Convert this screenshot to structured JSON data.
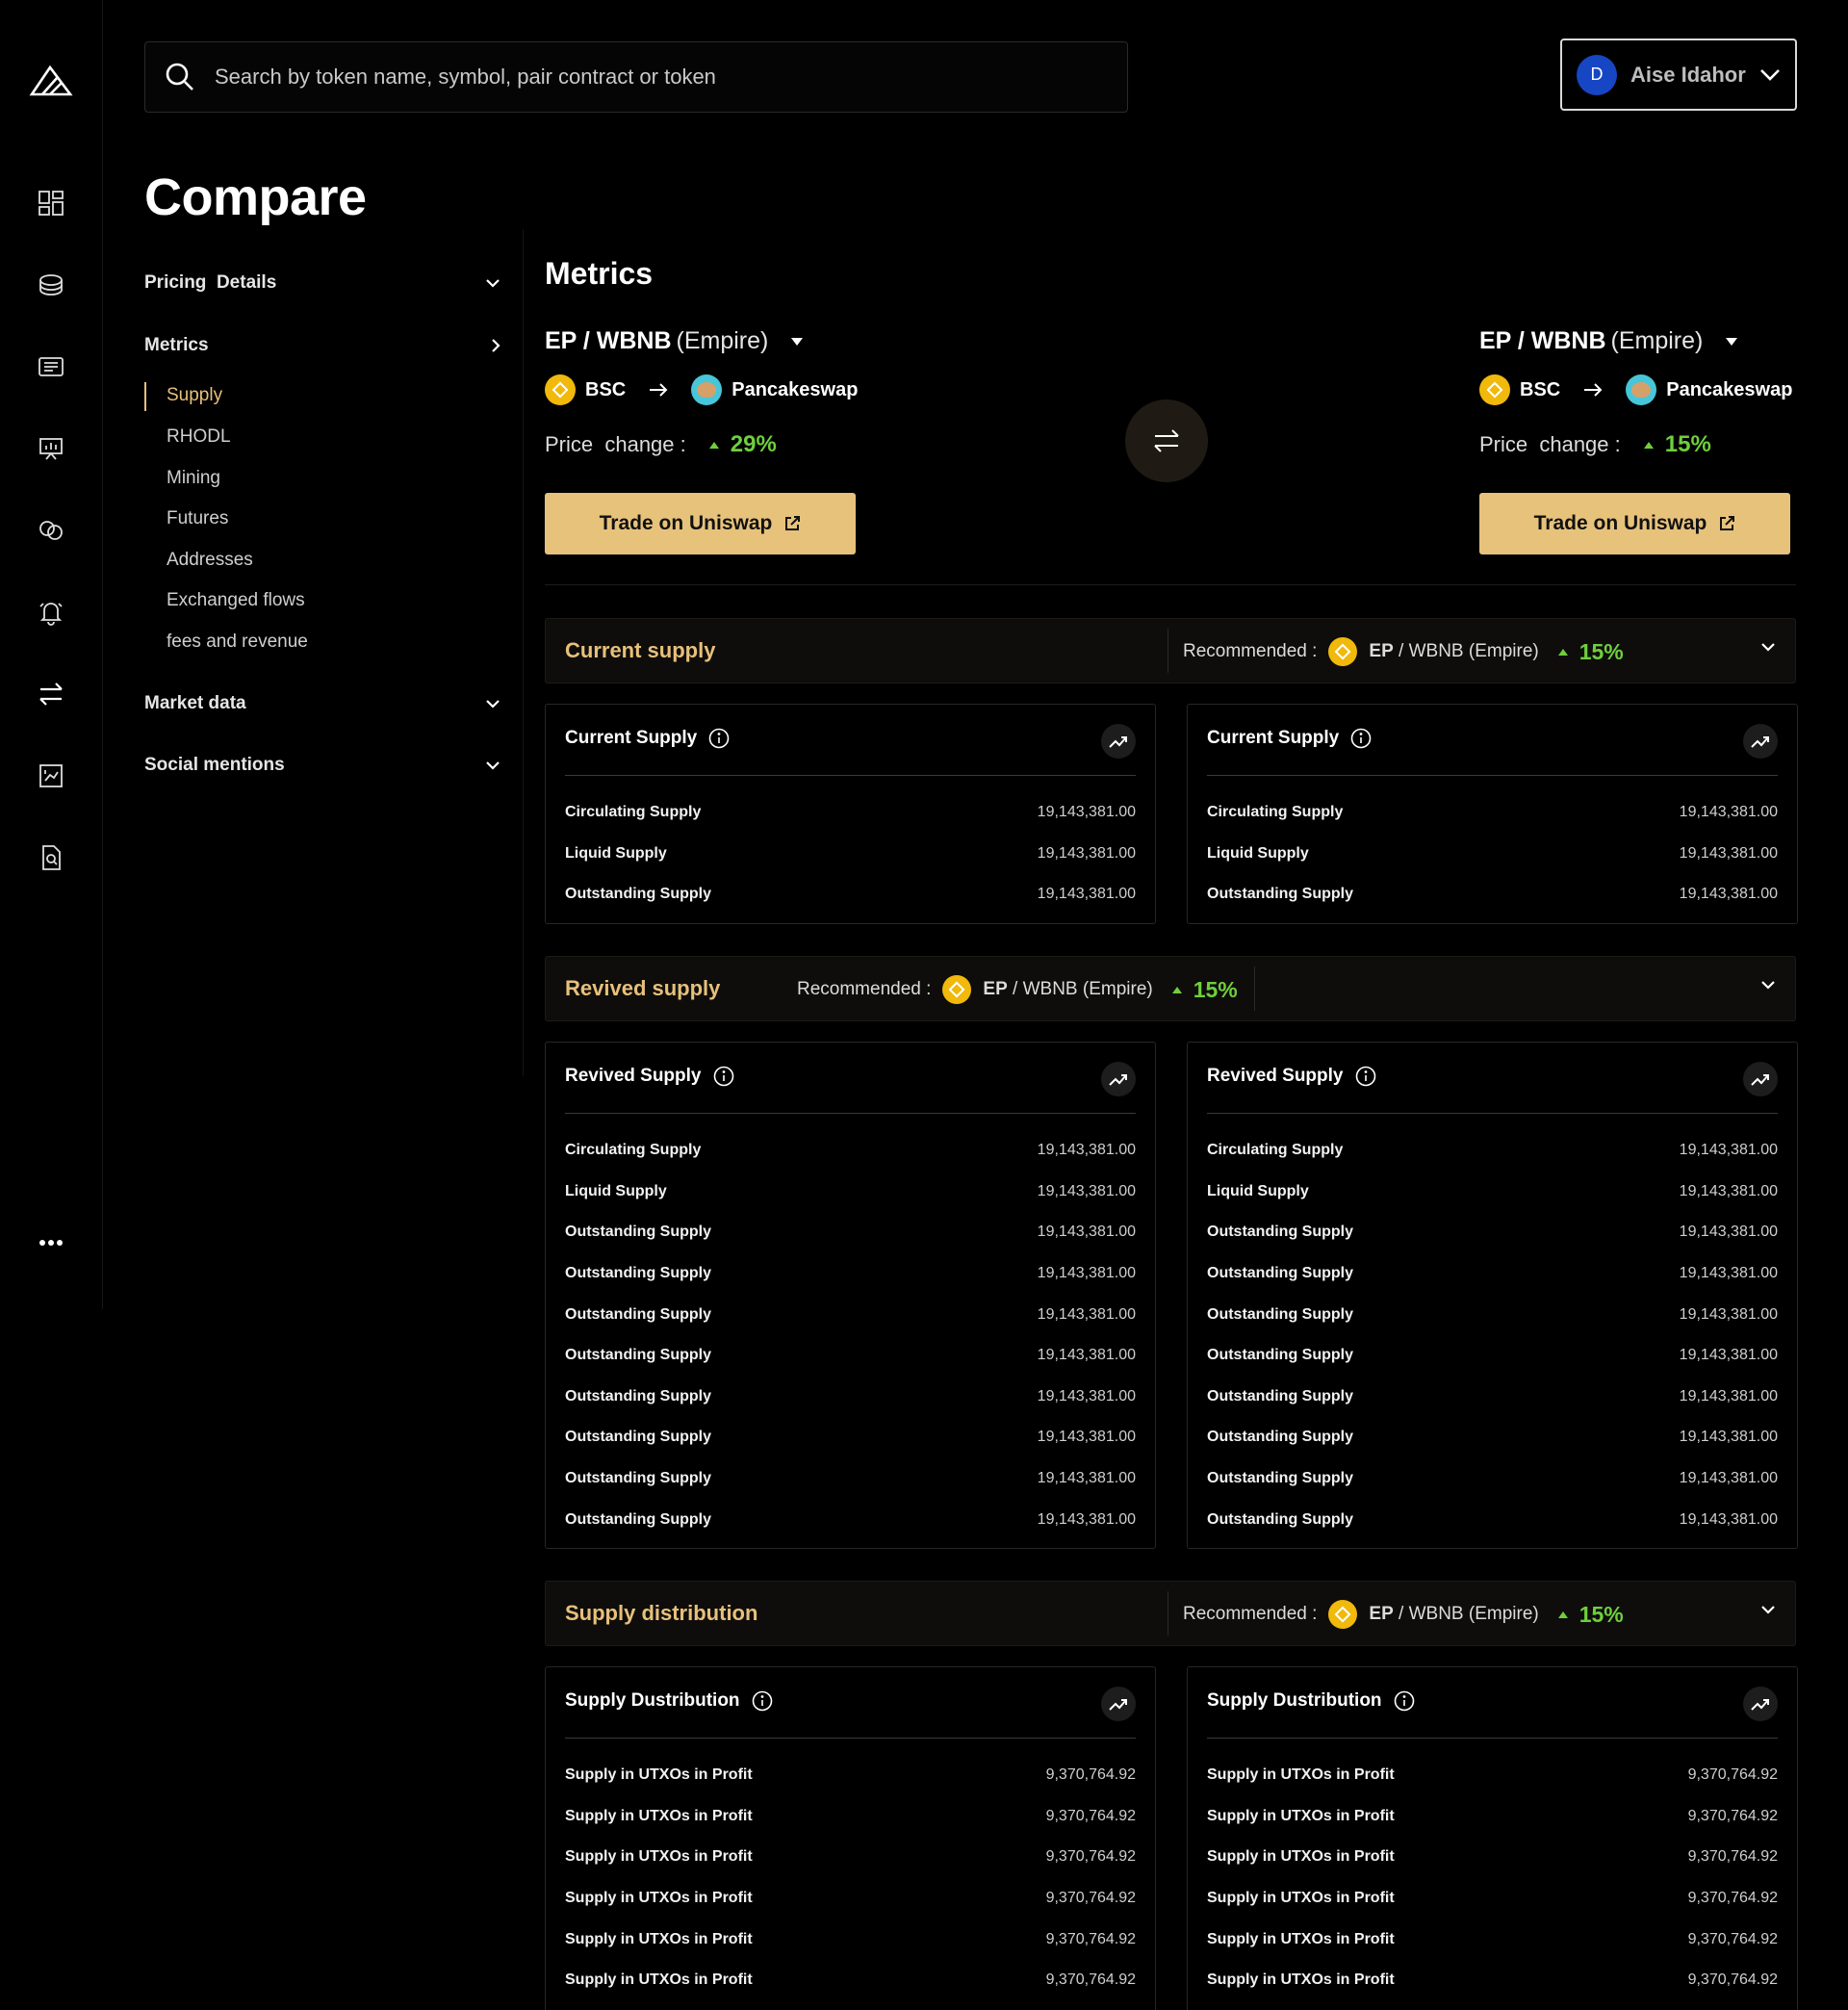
{
  "search": {
    "placeholder": "Search by token name, symbol, pair contract or token"
  },
  "user": {
    "initial": "D",
    "name": "Aise Idahor"
  },
  "page": {
    "title": "Compare"
  },
  "menu": {
    "pricing": "Pricing  Details",
    "metrics": "Metrics",
    "sub": [
      "Supply",
      "RHODL",
      "Mining",
      "Futures",
      "Addresses",
      "Exchanged flows",
      "fees and revenue"
    ],
    "market": "Market data",
    "social": "Social mentions"
  },
  "metrics_title": "Metrics",
  "left": {
    "pair": "EP / WBNB",
    "name": "(Empire)",
    "chain": "BSC",
    "dex": "Pancakeswap",
    "price_label": "Price  change :",
    "change": "29%",
    "trade": "Trade on Uniswap"
  },
  "right": {
    "pair": "EP / WBNB",
    "name": "(Empire)",
    "chain": "BSC",
    "dex": "Pancakeswap",
    "price_label": "Price  change :",
    "change": "15%",
    "trade": "Trade on Uniswap"
  },
  "recommended": {
    "label": "Recommended :",
    "ep": "EP",
    "rest": " / WBNB (Empire)",
    "pct": "15%"
  },
  "sections": {
    "current": {
      "title": "Current supply",
      "card_title": "Current Supply",
      "rows": [
        [
          "Circulating Supply",
          "19,143,381.00"
        ],
        [
          "Liquid Supply",
          "19,143,381.00"
        ],
        [
          "Outstanding Supply",
          "19,143,381.00"
        ]
      ]
    },
    "revived": {
      "title": "Revived supply",
      "card_title": "Revived Supply",
      "rows": [
        [
          "Circulating Supply",
          "19,143,381.00"
        ],
        [
          "Liquid Supply",
          "19,143,381.00"
        ],
        [
          "Outstanding Supply",
          "19,143,381.00"
        ],
        [
          "Outstanding Supply",
          "19,143,381.00"
        ],
        [
          "Outstanding Supply",
          "19,143,381.00"
        ],
        [
          "Outstanding Supply",
          "19,143,381.00"
        ],
        [
          "Outstanding Supply",
          "19,143,381.00"
        ],
        [
          "Outstanding Supply",
          "19,143,381.00"
        ],
        [
          "Outstanding Supply",
          "19,143,381.00"
        ],
        [
          "Outstanding Supply",
          "19,143,381.00"
        ]
      ]
    },
    "distribution": {
      "title": "Supply distribution",
      "card_title": "Supply Dustribution",
      "rows": [
        [
          "Supply in UTXOs in Profit",
          "9,370,764.92"
        ],
        [
          "Supply in UTXOs in Profit",
          "9,370,764.92"
        ],
        [
          "Supply in UTXOs in Profit",
          "9,370,764.92"
        ],
        [
          "Supply in UTXOs in Profit",
          "9,370,764.92"
        ],
        [
          "Supply in UTXOs in Profit",
          "9,370,764.92"
        ],
        [
          "Supply in UTXOs in Profit",
          "9,370,764.92"
        ]
      ]
    }
  },
  "icons": [
    "logo-icon",
    "dashboard-icon",
    "coins-icon",
    "news-icon",
    "presentation-icon",
    "compare-circles-icon",
    "bell-icon",
    "swap-arrows-icon",
    "report-icon",
    "search-document-icon",
    "more-icon"
  ],
  "colors": {
    "accent": "#e7c07a",
    "positive": "#6fcf3c",
    "button": "#e7c27b",
    "avatar": "#1646c4"
  }
}
